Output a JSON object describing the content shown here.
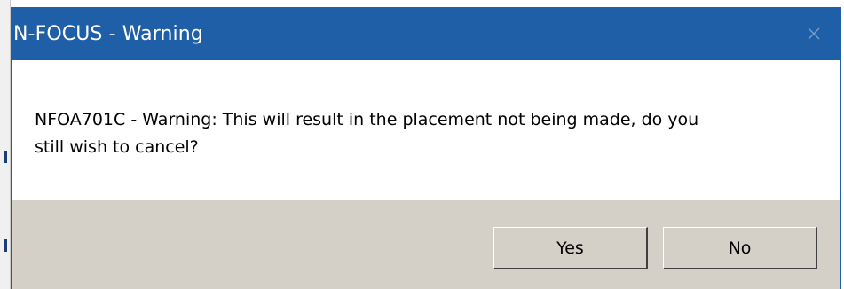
{
  "window": {
    "title": "N-FOCUS - Warning"
  },
  "message": {
    "line1": "NFOA701C - Warning:  This will result in the placement not being made, do you",
    "line2": "still wish to cancel?"
  },
  "buttons": {
    "yes_label": "Yes",
    "no_label": "No"
  },
  "icons": {
    "close": "close-icon"
  },
  "colors": {
    "titlebar": "#1f5fa8",
    "button_area": "#d4d0c8",
    "content_bg": "#ffffff"
  }
}
